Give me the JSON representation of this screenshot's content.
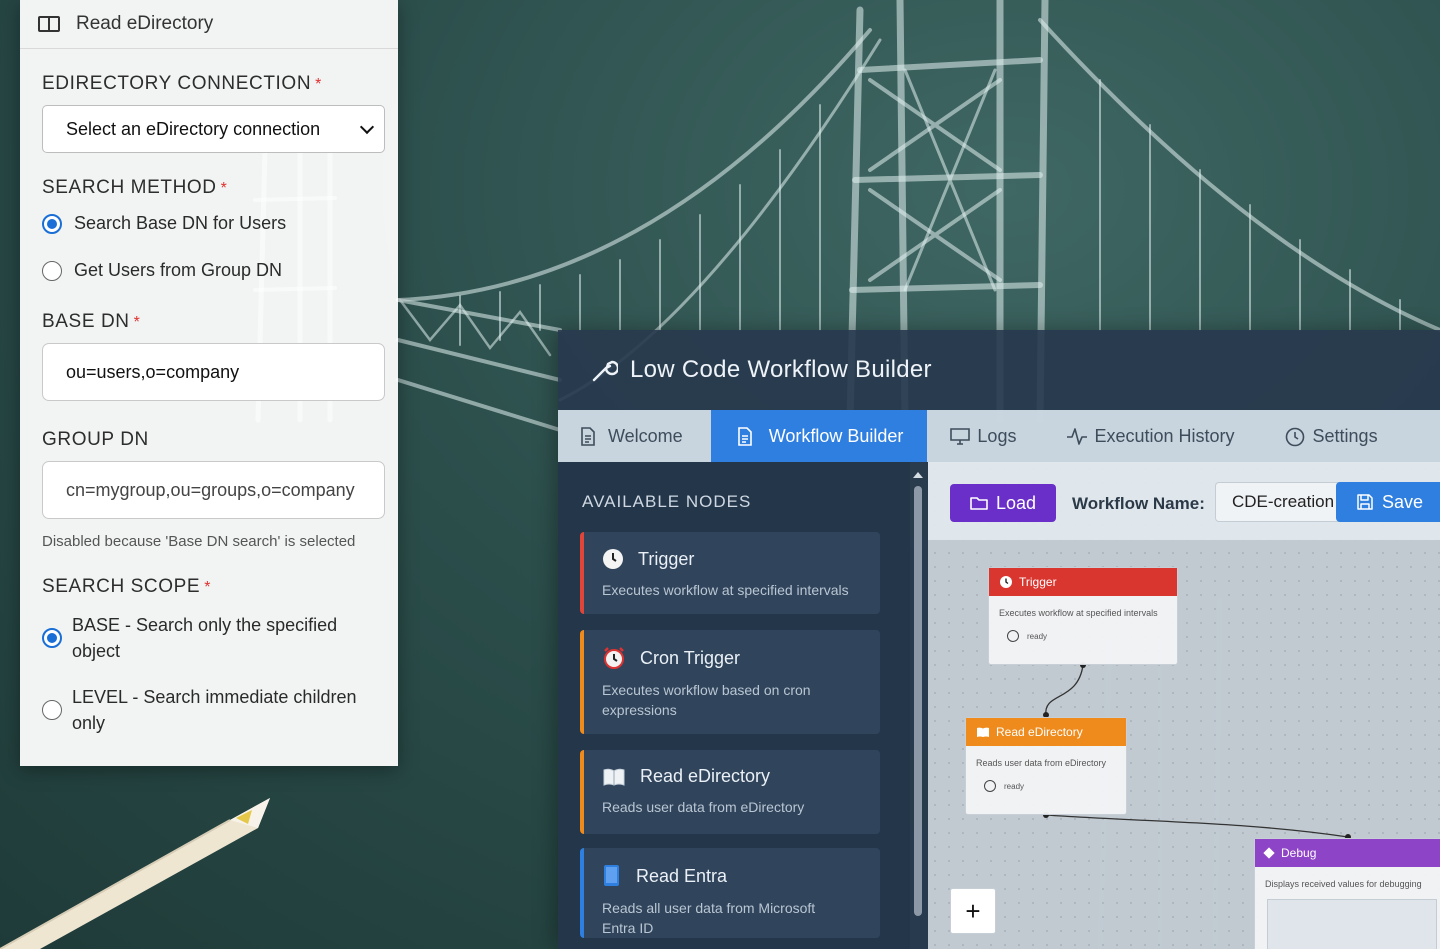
{
  "panel": {
    "header_title": "Read eDirectory",
    "connection": {
      "label": "EDIRECTORY CONNECTION",
      "required_mark": "*",
      "selected": "Select an eDirectory connection"
    },
    "search_method": {
      "label": "SEARCH METHOD",
      "required_mark": "*",
      "options": [
        {
          "label": "Search Base DN for Users",
          "checked": true
        },
        {
          "label": "Get Users from Group DN",
          "checked": false
        }
      ]
    },
    "base_dn": {
      "label": "BASE DN",
      "required_mark": "*",
      "value": "ou=users,o=company"
    },
    "group_dn": {
      "label": "GROUP DN",
      "value": "cn=mygroup,ou=groups,o=company",
      "hint": "Disabled because 'Base DN search' is selected"
    },
    "search_scope": {
      "label": "SEARCH SCOPE",
      "required_mark": "*",
      "options": [
        {
          "label": "BASE - Search only the specified object",
          "checked": true
        },
        {
          "label": "LEVEL - Search immediate children only",
          "checked": false
        }
      ]
    }
  },
  "workflow": {
    "title": "Low Code Workflow Builder",
    "tabs": [
      {
        "label": "Welcome",
        "icon": "document-icon",
        "active": false
      },
      {
        "label": "Workflow Builder",
        "icon": "document-icon",
        "active": true
      },
      {
        "label": "Logs",
        "icon": "monitor-icon",
        "active": false
      },
      {
        "label": "Execution History",
        "icon": "activity-icon",
        "active": false
      },
      {
        "label": "Settings",
        "icon": "clock-icon",
        "active": false
      }
    ],
    "available_nodes_title": "AVAILABLE NODES",
    "available_nodes": [
      {
        "name": "Trigger",
        "description": "Executes workflow at specified intervals",
        "accent": "#e0453a",
        "icon": "clock-icon"
      },
      {
        "name": "Cron Trigger",
        "description": "Executes workflow based on cron expressions",
        "accent": "#ef8a1d",
        "icon": "alarm-clock-icon"
      },
      {
        "name": "Read eDirectory",
        "description": "Reads user data from eDirectory",
        "accent": "#ef8a1d",
        "icon": "book-icon"
      },
      {
        "name": "Read Entra",
        "description": "Reads all user data from Microsoft Entra ID",
        "accent": "#2f7fe0",
        "icon": "book-blue-icon"
      }
    ],
    "toolbar": {
      "load_label": "Load",
      "name_label": "Workflow Name:",
      "name_value": "CDE-creation",
      "save_label": "Save"
    },
    "canvas_nodes": [
      {
        "name": "Trigger",
        "description": "Executes workflow at specified intervals",
        "status": "ready",
        "color": "#d9362f"
      },
      {
        "name": "Read eDirectory",
        "description": "Reads user data from eDirectory",
        "status": "ready",
        "color": "#ee8b1c"
      },
      {
        "name": "Debug",
        "description": "Displays received values for debugging",
        "color": "#8e44c6"
      }
    ],
    "zoom_in_label": "+"
  }
}
